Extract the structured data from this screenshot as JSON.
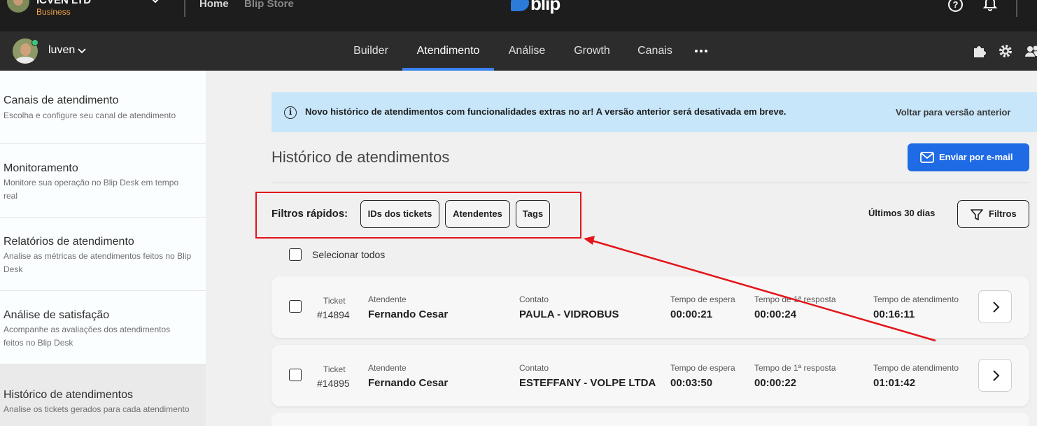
{
  "topbar": {
    "org_name": "ICVEN LTD",
    "plan": "Business",
    "home": "Home",
    "store": "Blip Store",
    "logo_text": "blip",
    "help_symbol": "?"
  },
  "navbar": {
    "user": "luven",
    "tabs": [
      "Builder",
      "Atendimento",
      "Análise",
      "Growth",
      "Canais"
    ],
    "active_tab": "Atendimento",
    "icons": [
      "puzzle-icon",
      "gear-icon",
      "users-icon"
    ]
  },
  "sidebar": {
    "items": [
      {
        "title": "Canais de atendimento",
        "desc": "Escolha e configure seu canal de atendimento"
      },
      {
        "title": "Monitoramento",
        "desc": "Monitore sua operação no Blip Desk em tempo real"
      },
      {
        "title": "Relatórios de atendimento",
        "desc": "Analise as métricas de atendimentos feitos no Blip Desk"
      },
      {
        "title": "Análise de satisfação",
        "desc": "Acompanhe as avaliações dos atendimentos feitos no Blip Desk"
      },
      {
        "title": "Histórico de atendimentos",
        "desc": "Analise os tickets gerados para cada atendimento"
      }
    ],
    "active_index": 4
  },
  "banner": {
    "text": "Novo histórico de atendimentos com funcionalidades extras no ar! A versão anterior será desativada em breve.",
    "link": "Voltar para versão anterior",
    "icon_symbol": "i"
  },
  "page": {
    "title": "Histórico de atendimentos",
    "email_button": "Enviar por e-mail"
  },
  "filters": {
    "label": "Filtros rápidos:",
    "chips": [
      "IDs dos tickets",
      "Atendentes",
      "Tags"
    ],
    "range": "Últimos 30 dias",
    "button": "Filtros"
  },
  "select_all": "Selecionar todos",
  "columns": {
    "ticket": "Ticket",
    "agent": "Atendente",
    "contact": "Contato",
    "wait": "Tempo de espera",
    "first_response": "Tempo de 1ª resposta",
    "service": "Tempo de atendimento"
  },
  "tickets": [
    {
      "id": "#14894",
      "agent": "Fernando Cesar",
      "contact": "PAULA - VIDROBUS",
      "wait": "00:00:21",
      "first_response": "00:00:24",
      "service": "00:16:11"
    },
    {
      "id": "#14895",
      "agent": "Fernando Cesar",
      "contact": "ESTEFFANY - VOLPE LTDA",
      "wait": "00:03:50",
      "first_response": "00:00:22",
      "service": "01:01:42"
    }
  ],
  "colors": {
    "accent": "#1f6be5",
    "nav_underline": "#3a82f0",
    "banner_bg": "#c8e6fa",
    "annotation": "#e3141a",
    "plan": "#f0a34b"
  }
}
